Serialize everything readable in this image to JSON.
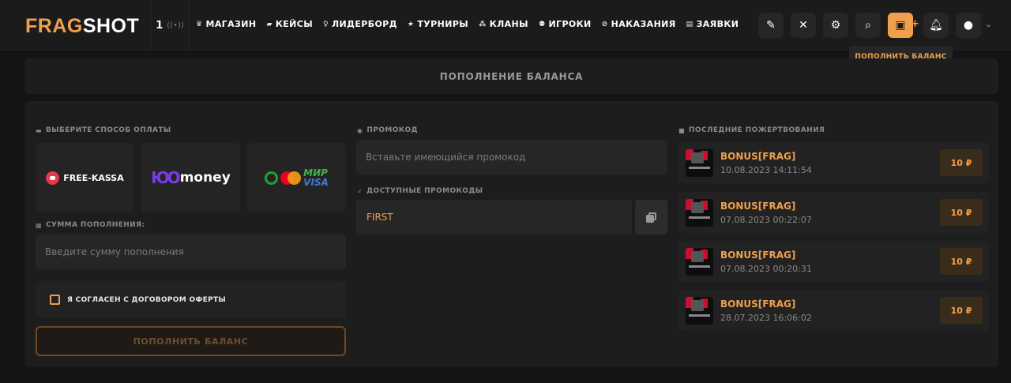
{
  "header": {
    "logo_part1": "FRAG",
    "logo_part2": "SHOT",
    "online_count": "1",
    "nav": [
      {
        "label": "МАГАЗИН",
        "icon": "crown-icon"
      },
      {
        "label": "КЕЙСЫ",
        "icon": "case-icon"
      },
      {
        "label": "ЛИДЕРБОРД",
        "icon": "medal-icon"
      },
      {
        "label": "ТУРНИРЫ",
        "icon": "star-icon"
      },
      {
        "label": "КЛАНЫ",
        "icon": "grid-icon"
      },
      {
        "label": "ИГРОКИ",
        "icon": "users-icon"
      },
      {
        "label": "НАКАЗАНИЯ",
        "icon": "ban-icon"
      },
      {
        "label": "ЗАЯВКИ",
        "icon": "list-icon"
      }
    ],
    "tooltip": "ПОПОЛНИТЬ БАЛАНС"
  },
  "page_title": "ПОПОЛНЕНИЕ БАЛАНСА",
  "payment": {
    "method_label": "ВЫБЕРИТЕ СПОСОБ ОПЛАТЫ",
    "methods": [
      "FREE-KASSA",
      "money",
      "МИР",
      "VISA"
    ],
    "amount_label": "СУММА ПОПОЛНЕНИЯ:",
    "amount_placeholder": "Введите сумму пополнения",
    "agree_label": "Я СОГЛАСЕН С ДОГОВОРОМ ОФЕРТЫ",
    "submit_label": "ПОПОЛНИТЬ БАЛАНС"
  },
  "promo": {
    "label": "ПРОМОКОД",
    "placeholder": "Вставьте имеющийся промокод",
    "available_label": "ДОСТУПНЫЕ ПРОМОКОДЫ",
    "codes": [
      "FIRST"
    ]
  },
  "donations": {
    "label": "ПОСЛЕДНИЕ ПОЖЕРТВОВАНИЯ",
    "items": [
      {
        "name": "BONUS[FRAG]",
        "date": "10.08.2023 14:11:54",
        "amount": "10 ₽"
      },
      {
        "name": "BONUS[FRAG]",
        "date": "07.08.2023 00:22:07",
        "amount": "10 ₽"
      },
      {
        "name": "BONUS[FRAG]",
        "date": "07.08.2023 00:20:31",
        "amount": "10 ₽"
      },
      {
        "name": "BONUS[FRAG]",
        "date": "28.07.2023 16:06:02",
        "amount": "10 ₽"
      }
    ]
  },
  "colors": {
    "accent": "#f0a04b",
    "background": "#141414",
    "panel": "#1d1d1d"
  }
}
